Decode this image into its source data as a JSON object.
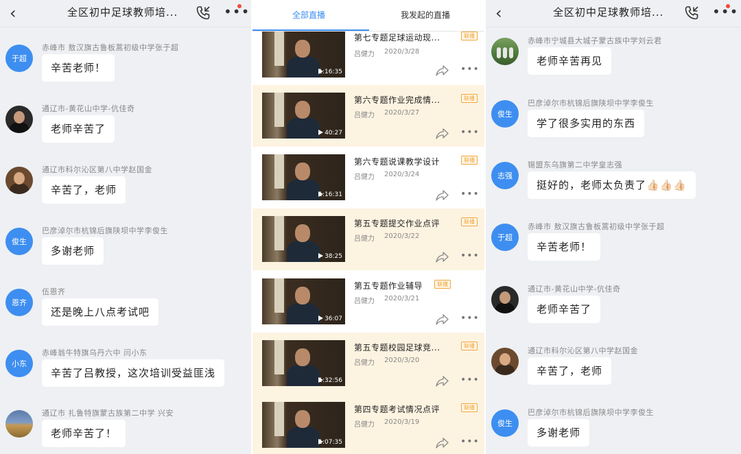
{
  "left_chat": {
    "title": "全区初中足球教师培...",
    "messages": [
      {
        "avatar_text": "于超",
        "sender": "赤峰市 敖汉旗古鲁板蒿初级中学张于超",
        "text": "辛苦老师！"
      },
      {
        "avatar_text": "",
        "sender": "通辽市-黄花山中学-伉佳奇",
        "text": "老师辛苦了"
      },
      {
        "avatar_text": "",
        "sender": "通辽市科尔沁区第八中学赵国金",
        "text": "辛苦了，老师"
      },
      {
        "avatar_text": "俊生",
        "sender": "巴彦淖尔市杭锦后旗陕坝中学李俊生",
        "text": "多谢老师"
      },
      {
        "avatar_text": "恩齐",
        "sender": "伍恩齐",
        "text": "还是晚上八点考试吧"
      },
      {
        "avatar_text": "小东",
        "sender": "赤峰翁牛特旗乌丹六中 闫小东",
        "text": "辛苦了吕教授，这次培训受益匪浅"
      },
      {
        "avatar_text": "",
        "sender": "通辽市 扎鲁特旗蒙古族第二中学 兴安",
        "text": "老师辛苦了！"
      }
    ]
  },
  "live_list": {
    "tabs": [
      "全部直播",
      "我发起的直播"
    ],
    "active_tab": "全部直播",
    "videos": [
      {
        "title": "第七专题足球运动现...",
        "badge": "联播",
        "author": "吕健力",
        "date": "2020/3/28",
        "duration": "1:16:35"
      },
      {
        "title": "第六专题作业完成情...",
        "badge": "联播",
        "author": "吕健力",
        "date": "2020/3/27",
        "duration": "40:27"
      },
      {
        "title": "第六专题说课教学设计",
        "badge": "联播",
        "author": "吕健力",
        "date": "2020/3/24",
        "duration": "1:16:31"
      },
      {
        "title": "第五专题提交作业点评",
        "badge": "联播",
        "author": "吕健力",
        "date": "2020/3/22",
        "duration": "38:25"
      },
      {
        "title": "第五专题作业辅导",
        "badge": "联播",
        "author": "吕健力",
        "date": "2020/3/21",
        "duration": "36:07"
      },
      {
        "title": "第五专题校园足球竞...",
        "badge": "联播",
        "author": "吕健力",
        "date": "2020/3/20",
        "duration": "1:32:56"
      },
      {
        "title": "第四专题考试情况点评",
        "badge": "联播",
        "author": "吕健力",
        "date": "2020/3/19",
        "duration": "1:07:35"
      }
    ],
    "highlight_color": "#fdf3e1"
  },
  "right_chat": {
    "title": "全区初中足球教师培...",
    "messages": [
      {
        "avatar_text": "",
        "sender": "赤峰市宁城县大城子蒙古族中学刘云君",
        "text": "老师辛苦再见"
      },
      {
        "avatar_text": "俊生",
        "sender": "巴彦淖尔市杭锦后旗陕坝中学李俊生",
        "text": "学了很多实用的东西"
      },
      {
        "avatar_text": "志强",
        "sender": "锡盟东乌旗第二中学皇志强",
        "text": "挺好的，老师太负责了👍🏻👍🏻👍🏻"
      },
      {
        "avatar_text": "于超",
        "sender": "赤峰市 敖汉旗古鲁板蒿初级中学张于超",
        "text": "辛苦老师！"
      },
      {
        "avatar_text": "",
        "sender": "通辽市-黄花山中学-伉佳奇",
        "text": "老师辛苦了"
      },
      {
        "avatar_text": "",
        "sender": "通辽市科尔沁区第八中学赵国金",
        "text": "辛苦了，老师"
      },
      {
        "avatar_text": "俊生",
        "sender": "巴彦淖尔市杭锦后旗陕坝中学李俊生",
        "text": "多谢老师"
      }
    ]
  },
  "icons": {
    "back": "chevron-left-icon",
    "call": "phone-call-icon",
    "more": "more-dots-icon",
    "share": "share-icon",
    "play": "play-icon"
  },
  "colors": {
    "accent": "#3d8ef0",
    "badge": "#f0a63a",
    "notification": "#f04b3c",
    "chat_background": "#eef0f3"
  }
}
